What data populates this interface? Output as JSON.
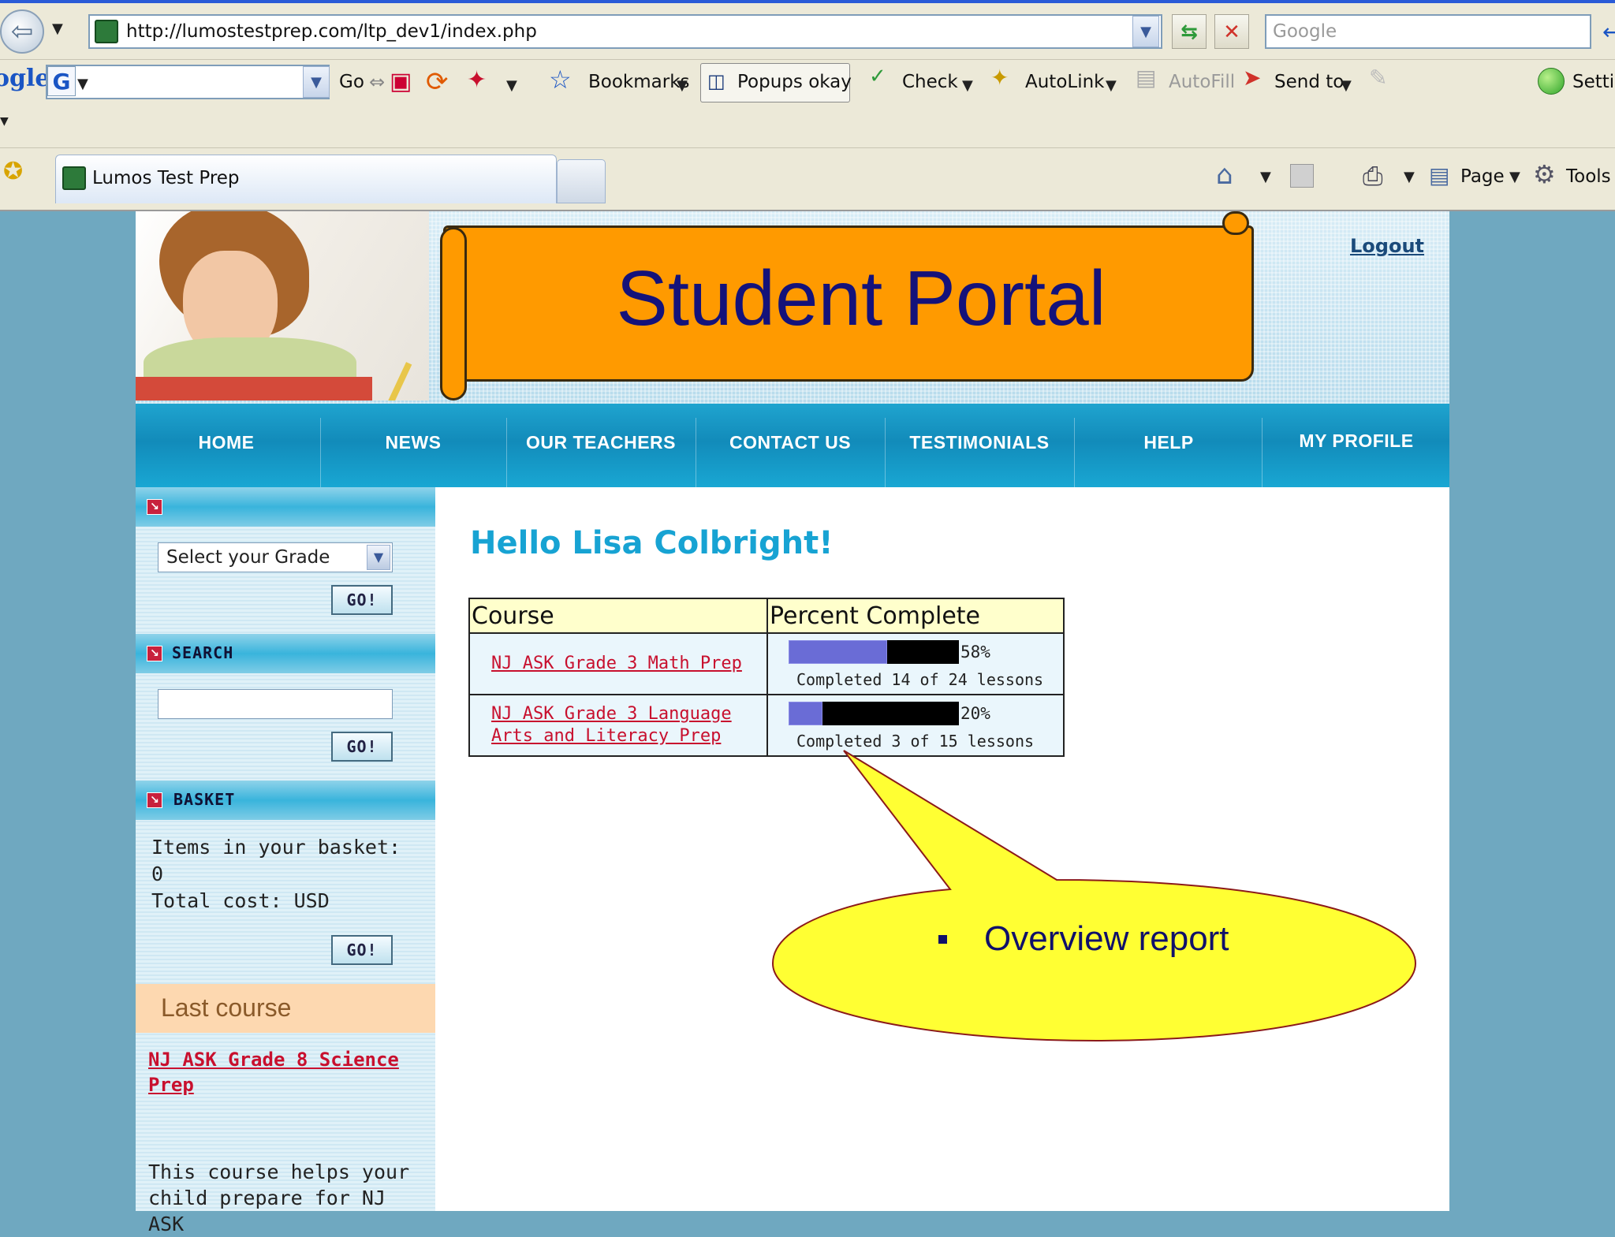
{
  "browser": {
    "url": "http://lumostestprep.com/ltp_dev1/index.php",
    "search_placeholder": "Google",
    "google_logo": "ogle",
    "toolbar": {
      "go": "Go",
      "bookmarks": "Bookmarks",
      "popups": "Popups okay",
      "check": "Check",
      "autolink": "AutoLink",
      "autofill": "AutoFill",
      "send_to": "Send to",
      "settings": "Settir"
    },
    "tab_title": "Lumos Test Prep",
    "command_bar": {
      "page": "Page",
      "tools": "Tools"
    }
  },
  "header": {
    "title": "Student Portal",
    "logout": "Logout"
  },
  "nav": [
    "HOME",
    "NEWS",
    "OUR TEACHERS",
    "CONTACT US",
    "TESTIMONIALS",
    "HELP",
    "MY PROFILE"
  ],
  "sidebar": {
    "grade_select": "Select your Grade",
    "go": "GO!",
    "search_title": "SEARCH",
    "basket_title": "BASKET",
    "basket_items_label": "Items in your basket:",
    "basket_items_count": "0",
    "basket_total": "Total cost: USD",
    "last_course_title": "Last course",
    "last_course_link": "NJ ASK Grade 8 Science Prep",
    "course_description": "This course helps your child prepare for NJ ASK"
  },
  "main": {
    "greeting": "Hello Lisa Colbright!",
    "table": {
      "headers": [
        "Course",
        "Percent Complete"
      ],
      "rows": [
        {
          "course": "NJ ASK Grade 3 Math Prep",
          "percent": 58,
          "percent_label": "58%",
          "completed": "Completed 14 of 24 lessons"
        },
        {
          "course": "NJ ASK Grade 3 Language Arts and Literacy Prep",
          "percent": 20,
          "percent_label": "20%",
          "completed": "Completed 3 of 15 lessons"
        }
      ]
    }
  },
  "callout": {
    "text": "Overview report",
    "fill": "#ffff33",
    "border": "#8b1a1a"
  },
  "colors": {
    "accent": "#17a3d3",
    "nav_bg": "#128bba",
    "banner": "#ff9a00",
    "link": "#c8102e",
    "progress": "#6a6cd6"
  }
}
